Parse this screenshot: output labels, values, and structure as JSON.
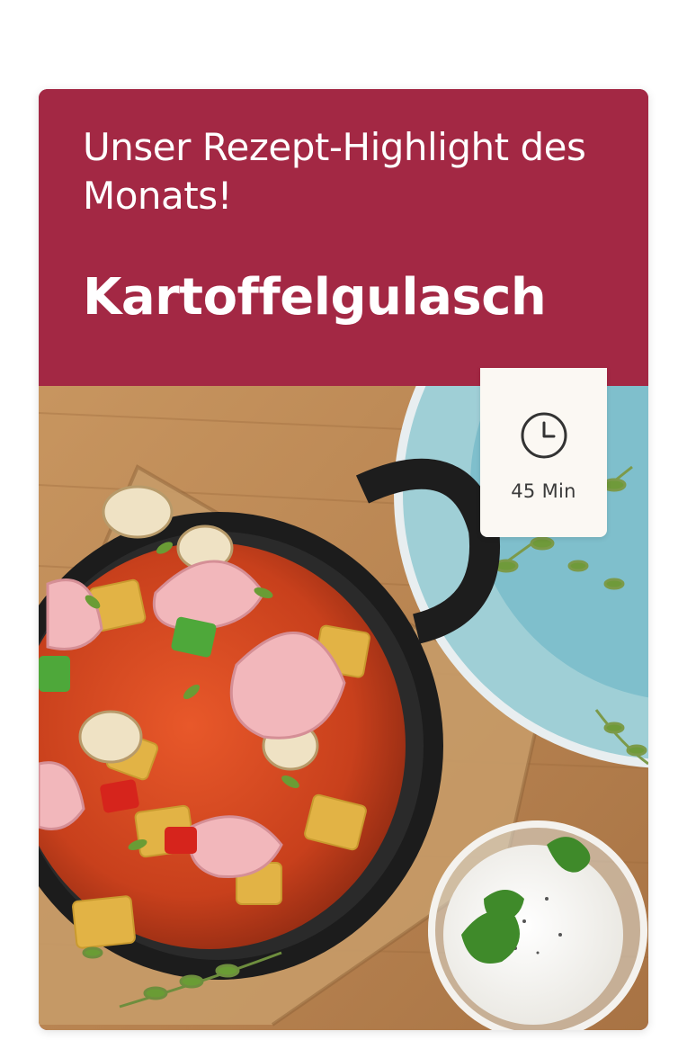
{
  "card": {
    "subtitle": "Unser Rezept-Highlight des Monats!",
    "title": "Kartoffelgulasch",
    "accent_color": "#a32844"
  },
  "time_badge": {
    "icon": "clock-icon",
    "label": "45 Min"
  },
  "photo": {
    "subject": "recipe-photo"
  }
}
